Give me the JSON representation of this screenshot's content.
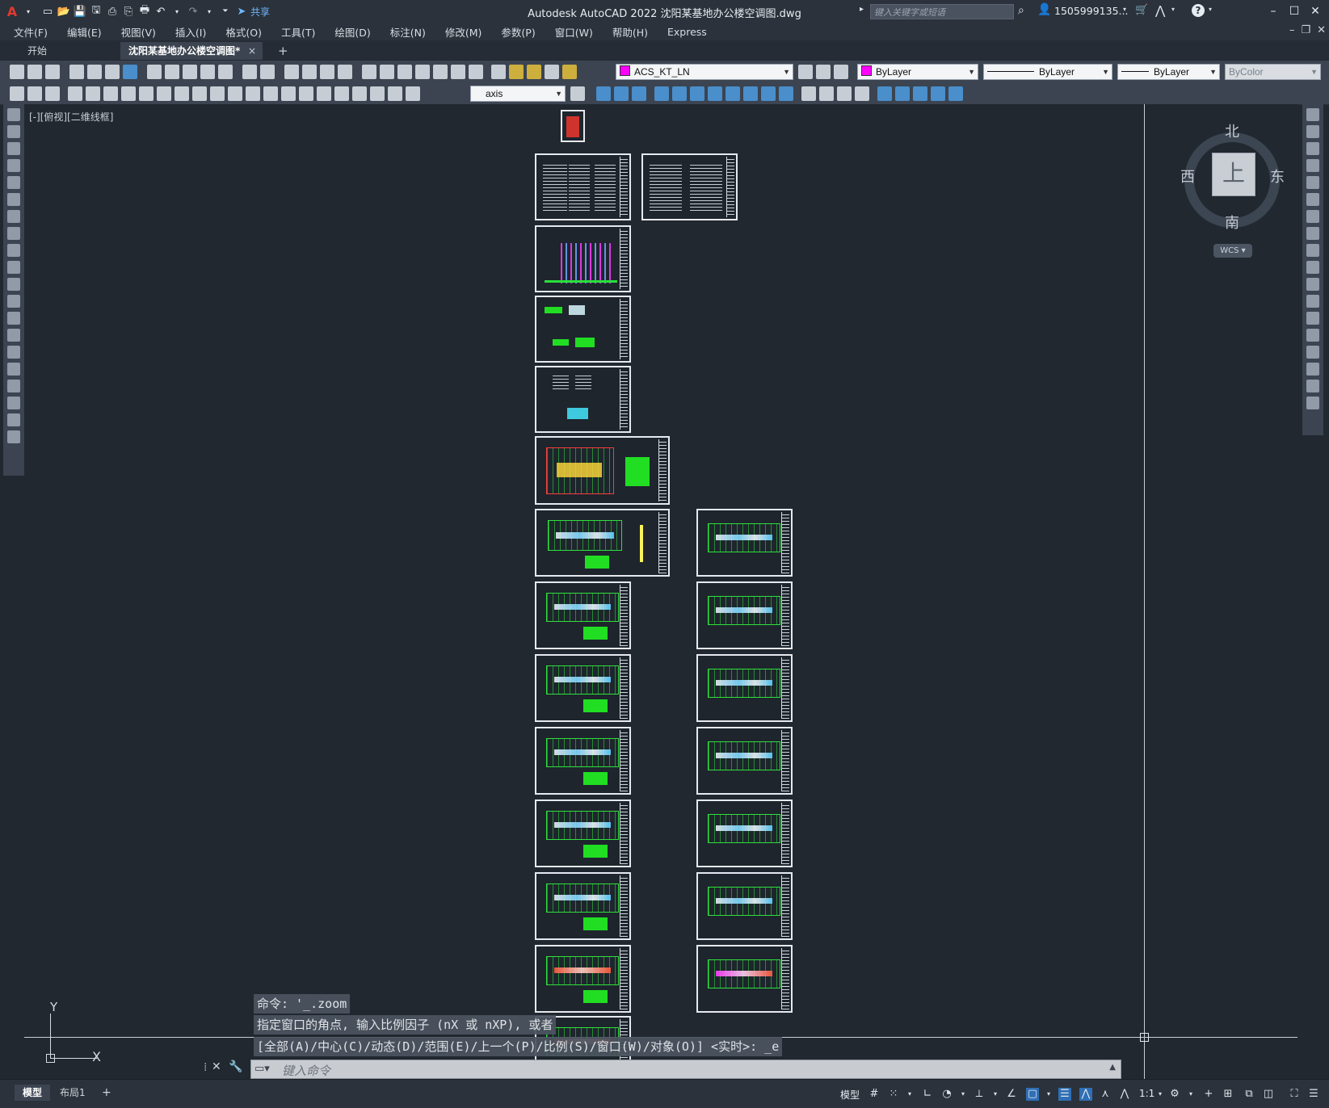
{
  "app": {
    "title": "Autodesk AutoCAD 2022    沈阳某基地办公楼空调图.dwg",
    "logo": "A",
    "share": "共享",
    "search_placeholder": "键入关键字或短语",
    "user": "1505999135...",
    "accent": "#e03a2f"
  },
  "menu": [
    "文件(F)",
    "编辑(E)",
    "视图(V)",
    "插入(I)",
    "格式(O)",
    "工具(T)",
    "绘图(D)",
    "标注(N)",
    "修改(M)",
    "参数(P)",
    "窗口(W)",
    "帮助(H)",
    "Express"
  ],
  "tabs": {
    "start": "开始",
    "active": "沈阳某基地办公楼空调图*",
    "close": "×",
    "add": "+"
  },
  "toolbar": {
    "layer": "ACS_KT_LN",
    "layer_color": "#ff00ff",
    "color": "ByLayer",
    "linetype": "ByLayer",
    "lineweight": "ByLayer",
    "plotstyle": "ByColor",
    "dimstyle": "axis"
  },
  "viewport": {
    "label": "[-][俯视][二维线框]"
  },
  "viewcube": {
    "top": "上",
    "north": "北",
    "south": "南",
    "east": "东",
    "west": "西",
    "wcs": "WCS"
  },
  "ucs": {
    "x": "X",
    "y": "Y"
  },
  "command": {
    "history": [
      "命令: '_.zoom",
      "指定窗口的角点, 输入比例因子 (nX 或 nXP), 或者",
      "[全部(A)/中心(C)/动态(D)/范围(E)/上一个(P)/比例(S)/窗口(W)/对象(O)] <实时>: _e"
    ],
    "placeholder": "键入命令"
  },
  "statusbar": {
    "model_tab": "模型",
    "layout_tab": "布局1",
    "add": "+",
    "model_label": "模型",
    "scale": "1:1"
  }
}
